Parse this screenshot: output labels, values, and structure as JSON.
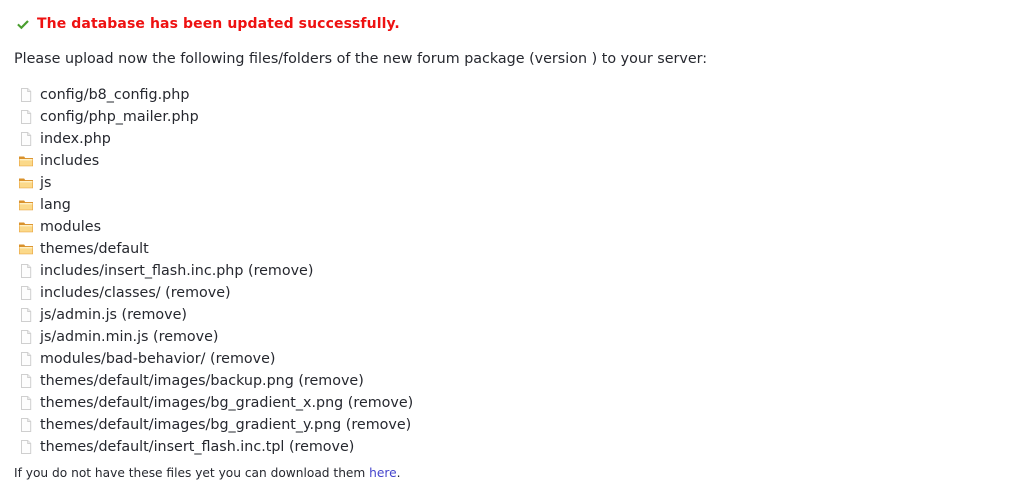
{
  "colors": {
    "background": "#ffffff",
    "success_red": "#ee1111",
    "check_green": "#4a9e2f",
    "body_text": "#26282f",
    "link_blue": "#4444cc",
    "folder_fill": "#f5c householder"
  },
  "status": {
    "icon": "check-icon",
    "message": "The database has been updated successfully."
  },
  "intro": {
    "text": "Please upload now the following files/folders of the new forum package (version ) to your server:",
    "version": ""
  },
  "file_list": [
    {
      "icon": "file-icon",
      "label": "config/b8_config.php"
    },
    {
      "icon": "file-icon",
      "label": "config/php_mailer.php"
    },
    {
      "icon": "file-icon",
      "label": "index.php"
    },
    {
      "icon": "folder-icon",
      "label": "includes"
    },
    {
      "icon": "folder-icon",
      "label": "js"
    },
    {
      "icon": "folder-icon",
      "label": "lang"
    },
    {
      "icon": "folder-icon",
      "label": "modules"
    },
    {
      "icon": "folder-icon",
      "label": "themes/default"
    },
    {
      "icon": "file-icon",
      "label": "includes/insert_flash.inc.php (remove)"
    },
    {
      "icon": "file-icon",
      "label": "includes/classes/ (remove)"
    },
    {
      "icon": "file-icon",
      "label": "js/admin.js (remove)"
    },
    {
      "icon": "file-icon",
      "label": "js/admin.min.js (remove)"
    },
    {
      "icon": "file-icon",
      "label": "modules/bad-behavior/ (remove)"
    },
    {
      "icon": "file-icon",
      "label": "themes/default/images/backup.png (remove)"
    },
    {
      "icon": "file-icon",
      "label": "themes/default/images/bg_gradient_x.png (remove)"
    },
    {
      "icon": "file-icon",
      "label": "themes/default/images/bg_gradient_y.png (remove)"
    },
    {
      "icon": "file-icon",
      "label": "themes/default/insert_flash.inc.tpl (remove)"
    }
  ],
  "footer": {
    "text_before": "If you do not have these files yet you can download them ",
    "link_label": "here",
    "text_after": "."
  }
}
